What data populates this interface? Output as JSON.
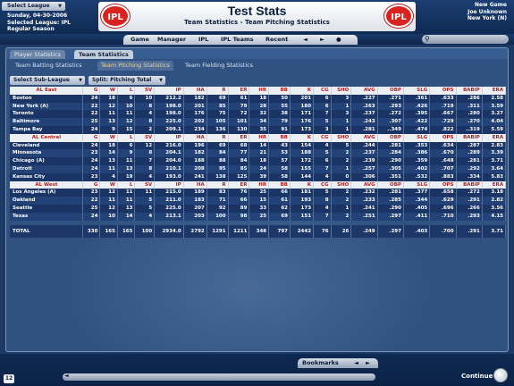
{
  "header": {
    "select_league": "Select League",
    "date": "Sunday, 04-30-2006",
    "selected_league": "Selected League: IPL",
    "season": "Regular Season",
    "logo_text": "IPL",
    "title": "Test Stats",
    "subtitle": "Team Statistics - Team Pitching Statistics",
    "new_game": "New Game",
    "manager": "Joe Unknown",
    "team": "New York (N)"
  },
  "nav": {
    "items": [
      "Game",
      "Manager",
      "IPL",
      "IPL Teams",
      "Recent"
    ],
    "back": "◄",
    "forward": "►"
  },
  "tabs": [
    "Player Statistics",
    "Team Statistics"
  ],
  "subtabs": [
    "Team Batting Statistics",
    "Team Pitching Statistics",
    "Team Fielding Statistics"
  ],
  "dropdowns": {
    "subleague": "Select Sub-League",
    "split": "Split: Pitching Total"
  },
  "columns": [
    "G",
    "W",
    "L",
    "SV",
    "IP",
    "HA",
    "R",
    "ER",
    "HR",
    "BB",
    "K",
    "CG",
    "SHO",
    "AVG",
    "OBP",
    "SLG",
    "OPS",
    "BABIP",
    "ERA"
  ],
  "divisions": [
    {
      "name": "AL East",
      "rows": [
        [
          "Boston",
          "24",
          "18",
          "6",
          "10",
          "212.2",
          "182",
          "69",
          "61",
          "18",
          "50",
          "201",
          "6",
          "3",
          ".227",
          ".271",
          ".361",
          ".633",
          ".286",
          "2.58"
        ],
        [
          "New York (A)",
          "22",
          "12",
          "10",
          "8",
          "198.0",
          "201",
          "85",
          "79",
          "28",
          "55",
          "180",
          "6",
          "1",
          ".263",
          ".293",
          ".426",
          ".719",
          ".311",
          "3.59"
        ],
        [
          "Toronto",
          "22",
          "11",
          "11",
          "4",
          "198.0",
          "176",
          "75",
          "72",
          "32",
          "38",
          "171",
          "7",
          "3",
          ".237",
          ".272",
          ".395",
          ".667",
          ".280",
          "3.27"
        ],
        [
          "Baltimore",
          "25",
          "13",
          "12",
          "8",
          "225.0",
          "202",
          "105",
          "101",
          "34",
          "79",
          "176",
          "5",
          "1",
          ".243",
          ".307",
          ".422",
          ".729",
          ".270",
          "4.04"
        ],
        [
          "Tampa Bay",
          "24",
          "9",
          "15",
          "2",
          "209.1",
          "234",
          "136",
          "130",
          "35",
          "91",
          "173",
          "3",
          "1",
          ".281",
          "..349",
          ".474",
          ".822",
          "..319",
          "5.59"
        ]
      ]
    },
    {
      "name": "AL Central",
      "rows": [
        [
          "Cleveland",
          "24",
          "18",
          "6",
          "12",
          "216.0",
          "196",
          "69",
          "68",
          "14",
          "43",
          "154",
          "4",
          "5",
          ".244",
          ".281",
          ".353",
          ".634",
          ".287",
          "2.83"
        ],
        [
          "Minnesota",
          "23",
          "14",
          "9",
          "8",
          "204.1",
          "182",
          "84",
          "77",
          "21",
          "53",
          "188",
          "5",
          "2",
          ".237",
          ".284",
          ".386",
          ".670",
          ".289",
          "3.39"
        ],
        [
          "Chicago (A)",
          "24",
          "13",
          "11",
          "7",
          "204.0",
          "188",
          "88",
          "84",
          "18",
          "57",
          "172",
          "6",
          "2",
          ".239",
          ".290",
          ".359",
          ".648",
          ".281",
          "3.71"
        ],
        [
          "Detroit",
          "24",
          "11",
          "13",
          "8",
          "210.1",
          "208",
          "95",
          "85",
          "24",
          "58",
          "155",
          "7",
          "1",
          ".257",
          ".305",
          ".402",
          ".707",
          ".292",
          "3.64"
        ],
        [
          "Kansas City",
          "23",
          "4",
          "19",
          "4",
          "193.0",
          "241",
          "138",
          "125",
          "39",
          "58",
          "144",
          "4",
          "0",
          ".306",
          ".351",
          ".532",
          ".883",
          ".334",
          "5.83"
        ]
      ]
    },
    {
      "name": "AL West",
      "rows": [
        [
          "Los Angeles (A)",
          "23",
          "12",
          "11",
          "11",
          "215.0",
          "189",
          "83",
          "76",
          "25",
          "66",
          "181",
          "5",
          "2",
          ".232",
          ".281",
          ".377",
          ".658",
          ".272",
          "3.18"
        ],
        [
          "Oakland",
          "22",
          "11",
          "11",
          "5",
          "211.0",
          "183",
          "71",
          "66",
          "15",
          "61",
          "193",
          "8",
          "2",
          ".233",
          ".285",
          ".344",
          ".629",
          ".291",
          "2.82"
        ],
        [
          "Seattle",
          "25",
          "12",
          "13",
          "5",
          "225.0",
          "207",
          "92",
          "89",
          "33",
          "62",
          "173",
          "4",
          "1",
          ".241",
          ".290",
          ".405",
          ".696",
          ".266",
          "3.56"
        ],
        [
          "Texas",
          "24",
          "10",
          "14",
          "4",
          "213.1",
          "203",
          "100",
          "98",
          "25",
          "69",
          "151",
          "7",
          "2",
          ".251",
          ".297",
          ".411",
          ".710",
          ".293",
          "4.15"
        ]
      ]
    }
  ],
  "total": [
    "TOTAL",
    "330",
    "165",
    "165",
    "100",
    "2934.0",
    "2792",
    "1291",
    "1211",
    "348",
    "797",
    "2442",
    "76",
    "26",
    ".249",
    ".297",
    ".403",
    ".700",
    ".291",
    "3.71"
  ],
  "footer": {
    "bookmarks": "Bookmarks",
    "continue": "Continue",
    "badge": "12"
  }
}
